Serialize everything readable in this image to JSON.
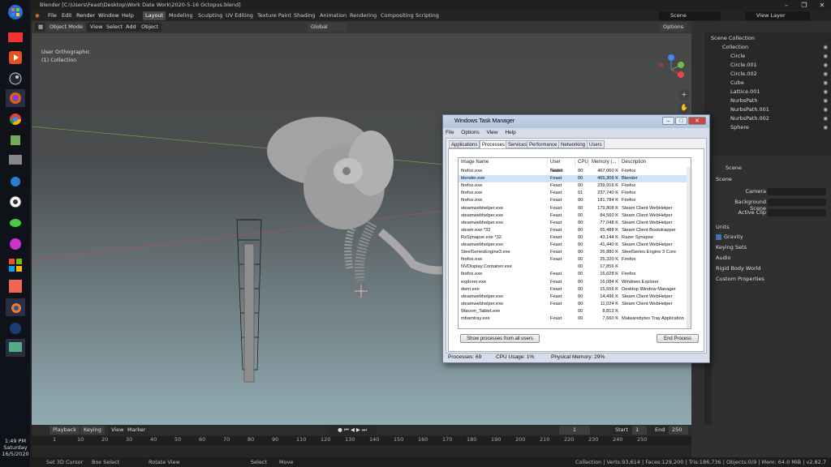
{
  "taskbar": {
    "time": "1:49 PM",
    "day": "Saturday",
    "date": "16/5/2020"
  },
  "blender": {
    "title": "Blender [C:\\Users\\Feast\\Desktop\\Work Date Work\\2020-5-16 Octopus.blend]",
    "menu": [
      "File",
      "Edit",
      "Render",
      "Window",
      "Help"
    ],
    "workspaces": [
      "Layout",
      "Modeling",
      "Sculpting",
      "UV Editing",
      "Texture Paint",
      "Shading",
      "Animation",
      "Rendering",
      "Compositing",
      "Scripting"
    ],
    "scene": "Scene",
    "view_layer": "View Layer"
  },
  "viewport": {
    "mode": "Object Mode",
    "view": "View",
    "select": "Select",
    "add": "Add",
    "object": "Object",
    "orientation": "Global",
    "options": "Options",
    "overlay_line1": "User Orthographic",
    "overlay_line2": "(1) Collection",
    "gizmo": {
      "x": "X",
      "y": "Y",
      "z": "Z"
    }
  },
  "outliner": {
    "header": "Scene Collection",
    "items": [
      "Collection",
      "Circle",
      "Circle.001",
      "Circle.002",
      "Cube",
      "Lattice.001",
      "NurbsPath",
      "NurbsPath.001",
      "NurbsPath.002",
      "Sphere"
    ]
  },
  "properties": {
    "header": "Scene",
    "section": "Scene",
    "camera": "Camera",
    "background_scene": "Background Scene",
    "active_clip": "Active Clip",
    "units": "Units",
    "gravity": "Gravity",
    "keying_sets": "Keying Sets",
    "audio": "Audio",
    "rigid_body": "Rigid Body World",
    "custom_props": "Custom Properties"
  },
  "timeline": {
    "playback": "Playback",
    "keying": "Keying",
    "view": "View",
    "marker": "Marker",
    "current": "1",
    "start_label": "Start",
    "start": "1",
    "end_label": "End",
    "end": "250",
    "ticks": [
      "1",
      "10",
      "20",
      "30",
      "40",
      "50",
      "60",
      "70",
      "80",
      "90",
      "110",
      "120",
      "130",
      "140",
      "150",
      "160",
      "170",
      "180",
      "190",
      "200",
      "210",
      "220",
      "230",
      "240",
      "250"
    ]
  },
  "statusbar": {
    "a": "Set 3D Cursor",
    "b": "Box Select",
    "c": "Rotate View",
    "d": "Select",
    "e": "Move",
    "stats": "Collection | Verts:93,614 | Faces:129,200 | Tris:186,736 | Objects:0/9 | Mem: 64.0 MiB | v2.82.7"
  },
  "taskmanager": {
    "title": "Windows Task Manager",
    "menu": [
      "File",
      "Options",
      "View",
      "Help"
    ],
    "tabs": [
      "Applications",
      "Processes",
      "Services",
      "Performance",
      "Networking",
      "Users"
    ],
    "columns": [
      "Image Name",
      "User Name",
      "CPU",
      "Memory (...",
      "Description"
    ],
    "rows": [
      [
        "firefox.exe",
        "Feast",
        "00",
        "467,060 K",
        "Firefox"
      ],
      [
        "blender.exe",
        "Feast",
        "00",
        "465,308 K",
        "Blender"
      ],
      [
        "firefox.exe",
        "Feast",
        "00",
        "239,916 K",
        "Firefox"
      ],
      [
        "firefox.exe",
        "Feast",
        "01",
        "237,740 K",
        "Firefox"
      ],
      [
        "firefox.exe",
        "Feast",
        "00",
        "181,784 K",
        "Firefox"
      ],
      [
        "steamwebhelper.exe",
        "Feast",
        "00",
        "179,808 K",
        "Steam Client WebHelper"
      ],
      [
        "steamwebhelper.exe",
        "Feast",
        "00",
        "84,560 K",
        "Steam Client WebHelper"
      ],
      [
        "steamwebhelper.exe",
        "Feast",
        "00",
        "77,048 K",
        "Steam Client WebHelper"
      ],
      [
        "steam.exe *32",
        "Feast",
        "00",
        "65,488 K",
        "Steam Client Bootstrapper"
      ],
      [
        "RzSynapse.exe *32",
        "Feast",
        "00",
        "43,144 K",
        "Razer Synapse"
      ],
      [
        "steamwebhelper.exe",
        "Feast",
        "00",
        "41,440 K",
        "Steam Client WebHelper"
      ],
      [
        "SteelSeriesEngine3.exe",
        "Feast",
        "00",
        "26,880 K",
        "SteelSeries Engine 3 Core"
      ],
      [
        "firefox.exe",
        "Feast",
        "00",
        "25,320 K",
        "Firefox"
      ],
      [
        "NVDisplay.Container.exe",
        "",
        "00",
        "17,856 K",
        ""
      ],
      [
        "firefox.exe",
        "Feast",
        "00",
        "16,628 K",
        "Firefox"
      ],
      [
        "explorer.exe",
        "Feast",
        "00",
        "16,084 K",
        "Windows Explorer"
      ],
      [
        "dwm.exe",
        "Feast",
        "00",
        "15,556 K",
        "Desktop Window Manager"
      ],
      [
        "steamwebhelper.exe",
        "Feast",
        "00",
        "14,496 K",
        "Steam Client WebHelper"
      ],
      [
        "steamwebhelper.exe",
        "Feast",
        "00",
        "11,024 K",
        "Steam Client WebHelper"
      ],
      [
        "Wacom_Tablet.exe",
        "",
        "00",
        "8,812 K",
        ""
      ],
      [
        "mbamtray.exe",
        "Feast",
        "00",
        "7,660 K",
        "Malwarebytes Tray Application"
      ]
    ],
    "show_all": "Show processes from all users",
    "end_process": "End Process",
    "status_processes": "Processes: 69",
    "status_cpu": "CPU Usage: 1%",
    "status_mem": "Physical Memory: 29%"
  }
}
